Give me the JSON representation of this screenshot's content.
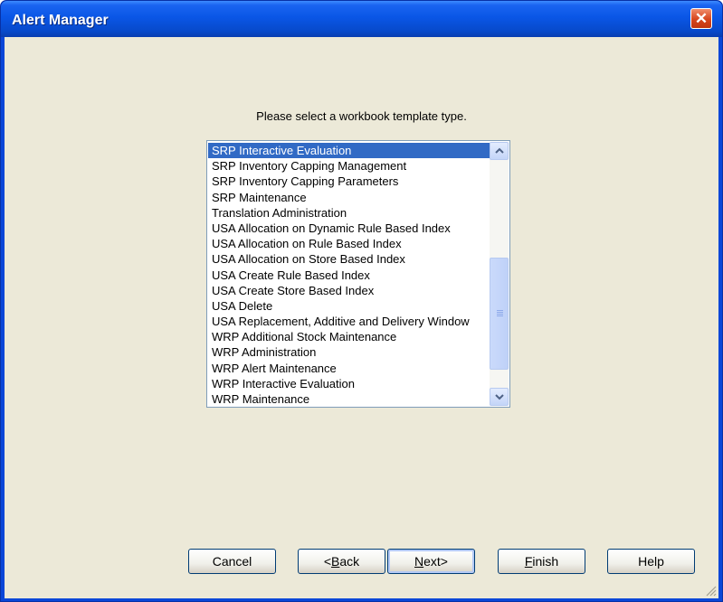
{
  "window": {
    "title": "Alert Manager",
    "close_glyph": "✕",
    "close_icon": "close-icon"
  },
  "prompt": "Please select a workbook template type.",
  "list": {
    "selected_index": 0,
    "items": [
      "SRP Interactive Evaluation",
      "SRP Inventory Capping Management",
      "SRP Inventory Capping Parameters",
      "SRP Maintenance",
      "Translation Administration",
      "USA Allocation on Dynamic Rule Based Index",
      "USA Allocation on Rule Based Index",
      "USA Allocation on Store Based Index",
      "USA Create Rule Based Index",
      "USA Create Store Based Index",
      "USA Delete",
      "USA Replacement, Additive and Delivery Window",
      "WRP Additional Stock Maintenance",
      "WRP Administration",
      "WRP Alert Maintenance",
      "WRP Interactive Evaluation",
      "WRP Maintenance"
    ],
    "scroll_icons": {
      "up": "chevron-up-icon",
      "down": "chevron-down-icon"
    }
  },
  "buttons": {
    "cancel": "Cancel",
    "back_prefix": "<",
    "back_accel": "B",
    "back_rest": "ack",
    "next_accel": "N",
    "next_rest": "ext>",
    "finish_accel": "F",
    "finish_rest": "inish",
    "help": "Help"
  },
  "colors": {
    "titlebar": "#0a56e6",
    "selection": "#316ac5",
    "dialog_bg": "#ece9d8"
  }
}
